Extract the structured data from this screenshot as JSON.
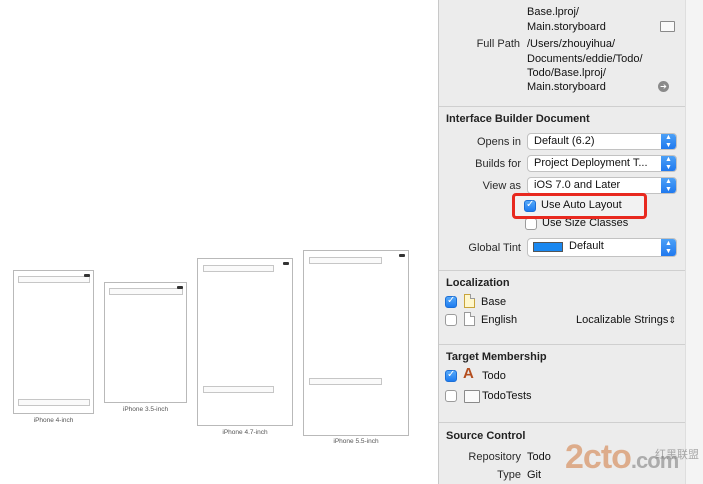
{
  "devices": [
    {
      "label": "iPhone 4-inch"
    },
    {
      "label": "iPhone 3.5-inch"
    },
    {
      "label": "iPhone 4.7-inch"
    },
    {
      "label": "iPhone 5.5-inch"
    }
  ],
  "identity": {
    "location_value": [
      "Base.lproj/",
      "Main.storyboard"
    ],
    "full_path_label": "Full Path",
    "full_path_value": [
      "/Users/zhouyihua/",
      "Documents/eddie/Todo/",
      "Todo/Base.lproj/",
      "Main.storyboard"
    ]
  },
  "ib_document": {
    "title": "Interface Builder Document",
    "opens_in_label": "Opens in",
    "opens_in_value": "Default (6.2)",
    "builds_for_label": "Builds for",
    "builds_for_value": "Project Deployment T...",
    "view_as_label": "View as",
    "view_as_value": "iOS 7.0 and Later",
    "use_auto_layout_label": "Use Auto Layout",
    "use_auto_layout_checked": true,
    "use_size_classes_label": "Use Size Classes",
    "use_size_classes_checked": false,
    "global_tint_label": "Global Tint",
    "global_tint_value": "Default",
    "global_tint_color": "#1a88f0"
  },
  "localization": {
    "title": "Localization",
    "items": [
      {
        "label": "Base",
        "checked": true
      },
      {
        "label": "English",
        "checked": false,
        "type": "Localizable Strings"
      }
    ]
  },
  "target_membership": {
    "title": "Target Membership",
    "items": [
      {
        "label": "Todo",
        "checked": true
      },
      {
        "label": "TodoTests",
        "checked": false
      }
    ]
  },
  "source_control": {
    "title": "Source Control",
    "repository_label": "Repository",
    "repository_value": "Todo",
    "type_label": "Type",
    "type_value": "Git"
  },
  "watermark": {
    "logo": "2cto",
    "site": ".com",
    "tag": "红黑联盟"
  },
  "colors": {
    "highlight": "#e8291f",
    "accent": "#1e7cf0"
  }
}
